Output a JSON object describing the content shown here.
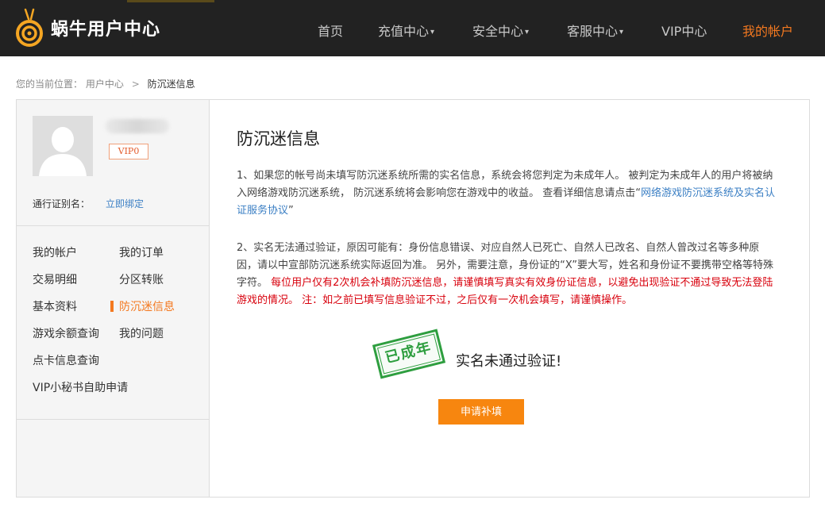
{
  "header": {
    "brand": "蜗牛用户中心",
    "nav": [
      {
        "label": "首页",
        "has_caret": false
      },
      {
        "label": "充值中心",
        "has_caret": true
      },
      {
        "label": "安全中心",
        "has_caret": true
      },
      {
        "label": "客服中心",
        "has_caret": true
      },
      {
        "label": "VIP中心",
        "has_caret": false
      },
      {
        "label": "我的帐户",
        "has_caret": false,
        "active": true
      }
    ],
    "caret_glyph": "▾"
  },
  "breadcrumb": {
    "prefix": "您的当前位置：",
    "parent": "用户中心",
    "separator": ">",
    "current": "防沉迷信息"
  },
  "sidebar": {
    "vip_badge": "VIP0",
    "pass_label": "通行证别名：",
    "pass_link": "立即绑定",
    "menu": [
      {
        "label": "我的帐户"
      },
      {
        "label": "我的订单"
      },
      {
        "label": "交易明细"
      },
      {
        "label": "分区转账"
      },
      {
        "label": "基本资料"
      },
      {
        "label": "防沉迷信息",
        "active": true
      },
      {
        "label": "游戏余额查询"
      },
      {
        "label": "我的问题"
      },
      {
        "label": "点卡信息查询"
      },
      {
        "label": "VIP小秘书自助申请"
      }
    ]
  },
  "content": {
    "title": "防沉迷信息",
    "para1_text": "1、如果您的帐号尚未填写防沉迷系统所需的实名信息，系统会将您判定为未成年人。 被判定为未成年人的用户将被纳入网络游戏防沉迷系统， 防沉迷系统将会影响您在游戏中的收益。 查看详细信息请点击“",
    "para1_link": "网络游戏防沉迷系统及实名认证服务协议",
    "para1_end": "”",
    "para2_text": "2、实名无法通过验证，原因可能有：身份信息错误、对应自然人已死亡、自然人已改名、自然人曾改过名等多种原因，请以中宣部防沉迷系统实际返回为准。 另外，需要注意，身份证的“X”要大写，姓名和身份证不要携带空格等特殊字符。 ",
    "para2_warn": "每位用户仅有2次机会补填防沉迷信息，请谨慎填写真实有效身份证信息，以避免出现验证不通过导致无法登陆游戏的情况。 注：如之前已填写信息验证不过，之后仅有一次机会填写，请谨慎操作。",
    "stamp": "已成年",
    "status": "实名未通过验证!",
    "apply_button": "申请补填"
  },
  "colors": {
    "header_bg": "#222222",
    "accent": "#f47920",
    "link": "#3b7fc4",
    "warning": "#d8000c",
    "stamp": "#2e9e3f",
    "button": "#f7860f"
  }
}
